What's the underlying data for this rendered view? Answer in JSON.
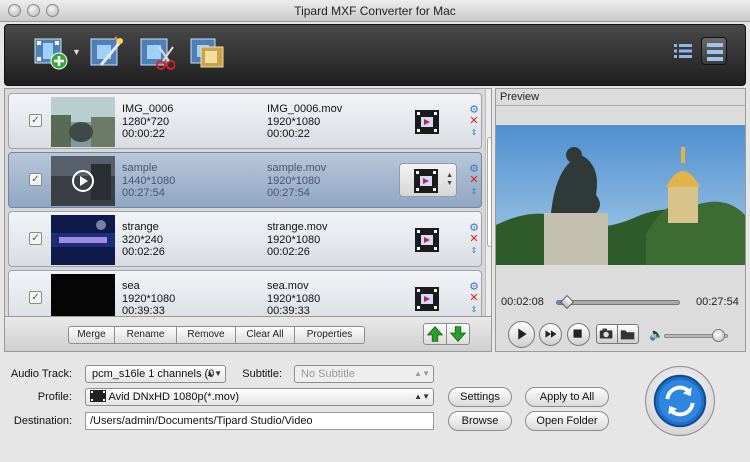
{
  "window": {
    "title": "Tipard MXF Converter for Mac"
  },
  "toolbar": {
    "add_icon": "add-video-icon",
    "edit_icon": "edit-magic-wand-icon",
    "clip_icon": "clip-scissors-icon",
    "merge_icon": "merge-films-icon",
    "view_list_icon": "list-view-icon",
    "view_detail_icon": "detail-view-icon"
  },
  "files": [
    {
      "name": "IMG_0006",
      "res": "1280*720",
      "duration": "00:00:22",
      "out_name": "IMG_0006.mov",
      "out_res": "1920*1080",
      "out_duration": "00:00:22",
      "selected": false
    },
    {
      "name": "sample",
      "res": "1440*1080",
      "duration": "00:27:54",
      "out_name": "sample.mov",
      "out_res": "1920*1080",
      "out_duration": "00:27:54",
      "selected": true
    },
    {
      "name": "strange",
      "res": "320*240",
      "duration": "00:02:26",
      "out_name": "strange.mov",
      "out_res": "1920*1080",
      "out_duration": "00:02:26",
      "selected": false
    },
    {
      "name": "sea",
      "res": "1920*1080",
      "duration": "00:39:33",
      "out_name": "sea.mov",
      "out_res": "1920*1080",
      "out_duration": "00:39:33",
      "selected": false
    }
  ],
  "list_actions": {
    "merge": "Merge",
    "rename": "Rename",
    "remove": "Remove",
    "clear_all": "Clear All",
    "properties": "Properties"
  },
  "preview": {
    "label": "Preview",
    "current_time": "00:02:08",
    "total_time": "00:27:54",
    "progress": 0.08,
    "volume": 0.85
  },
  "settings": {
    "audio_track_label": "Audio Track:",
    "audio_track_value": "pcm_s16le 1 channels (0",
    "subtitle_label": "Subtitle:",
    "subtitle_value": "No Subtitle",
    "profile_label": "Profile:",
    "profile_value": "Avid DNxHD 1080p(*.mov)",
    "destination_label": "Destination:",
    "destination_value": "/Users/admin/Documents/Tipard Studio/Video",
    "settings_button": "Settings",
    "apply_all_button": "Apply to All",
    "browse_button": "Browse",
    "open_folder_button": "Open Folder"
  },
  "colors": {
    "accent_blue": "#1f6fc8",
    "toolbar_dark": "#2b2b2b",
    "selected_row": "#9fb3cc"
  }
}
